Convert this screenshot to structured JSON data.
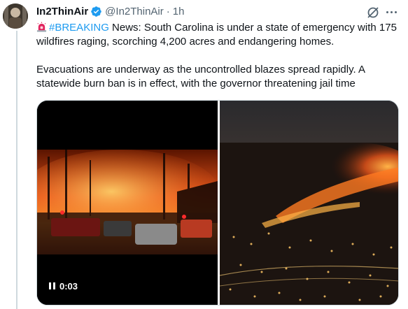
{
  "tweet": {
    "author_name": "In2ThinAir",
    "handle": "@In2ThinAir",
    "separator": "·",
    "time": "1h",
    "breaking_hashtag": "#BREAKING",
    "paragraph1_rest": " News: South Carolina is under a state of emergency with 175 wildfires raging, scorching 4,200 acres and endangering homes.",
    "paragraph2": "Evacuations are underway as the uncontrolled blazes spread rapidly. A statewide burn ban is in effect, with the governor threatening jail time"
  },
  "media": {
    "video_duration": "0:03"
  },
  "colors": {
    "accent": "#1d9bf0",
    "text": "#0f1419",
    "secondary": "#536471"
  }
}
